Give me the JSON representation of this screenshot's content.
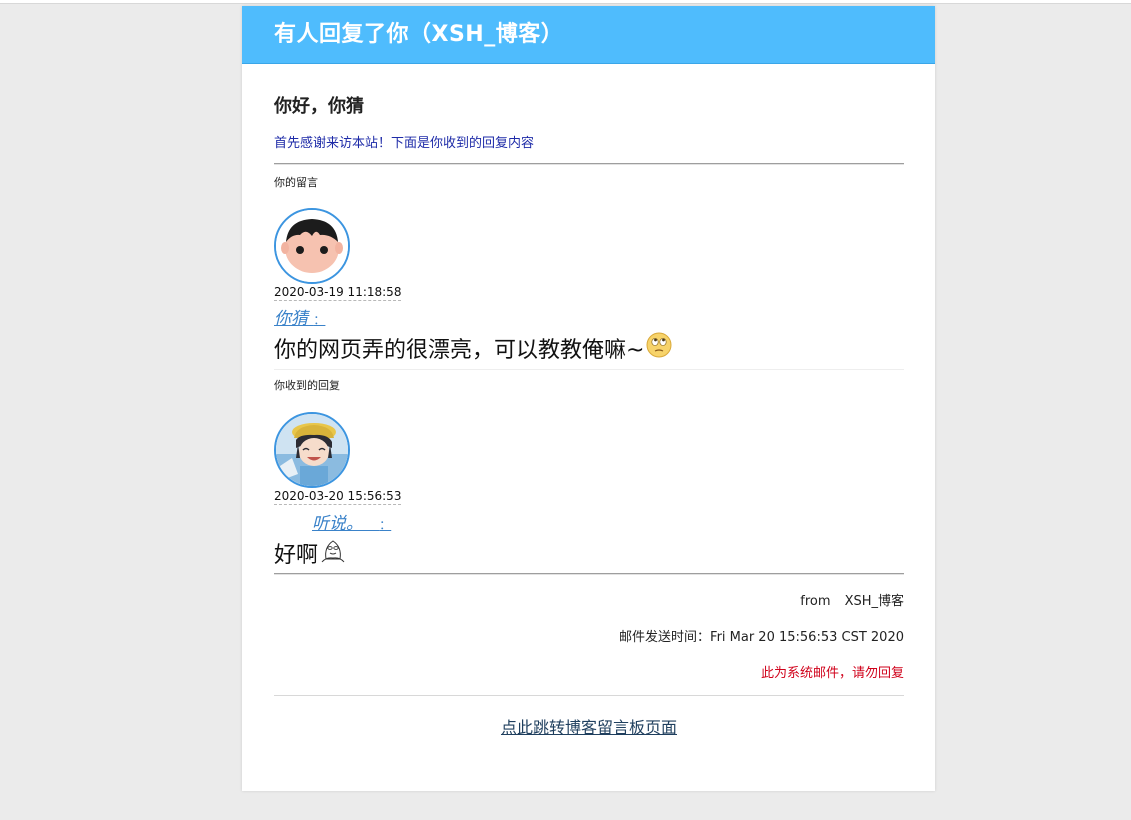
{
  "header": {
    "title": "有人回复了你（XSH_博客）"
  },
  "greeting": "你好，你猜",
  "intro": "首先感谢来访本站！下面是你收到的回复内容",
  "your_comment": {
    "section_label": "你的留言",
    "date": "2020-03-19 11:18:58",
    "author": "你猜",
    "colon": "：",
    "message": "你的网页弄的很漂亮，可以教教俺嘛~",
    "emoji": "rolling-eyes-emoji"
  },
  "reply": {
    "section_label": "你收到的回复",
    "date": "2020-03-20 15:56:53",
    "author": "听说。",
    "colon": "：",
    "message": "好啊",
    "emoji": "sketch-face-emoji"
  },
  "footer": {
    "from_label": "from",
    "from_site": "XSH_博客",
    "send_time": "邮件发送时间：Fri Mar 20 15:56:53 CST 2020",
    "system_note": "此为系统邮件，请勿回复",
    "jump_link": "点此跳转博客留言板页面"
  },
  "colors": {
    "header_bg": "#4fbcfd",
    "intro_text": "#1e2ba8",
    "author_link": "#3a82c9",
    "system_note": "#d0021b",
    "page_bg": "#ebebeb"
  }
}
